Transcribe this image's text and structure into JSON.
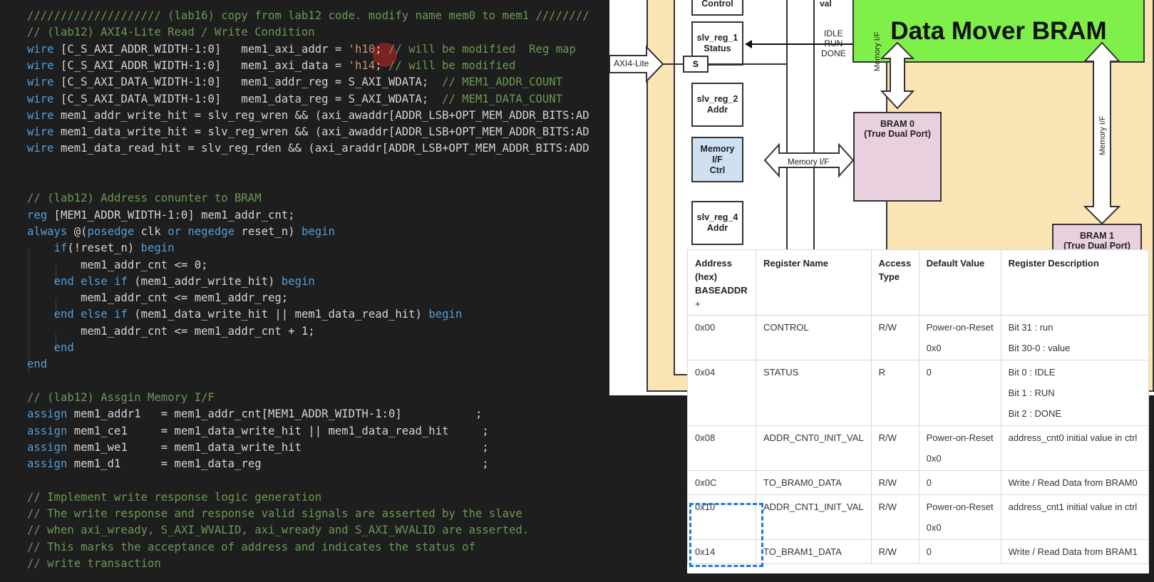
{
  "code": {
    "lines": [
      [
        [
          "cm",
          "//////////////////// (lab16) copy from lab12 code. modify name mem0 to mem1 ////////"
        ]
      ],
      [
        [
          "cm",
          "// (lab12) AXI4-Lite Read / Write Condition"
        ]
      ],
      [
        [
          "kw",
          "wire"
        ],
        [
          "pl",
          " [C_S_AXI_ADDR_WIDTH-1:0]   mem1_axi_addr = "
        ],
        [
          "str",
          "'h10"
        ],
        [
          "pl",
          ";"
        ],
        [
          "cm",
          " // will be modified  Reg map"
        ]
      ],
      [
        [
          "kw",
          "wire"
        ],
        [
          "pl",
          " [C_S_AXI_ADDR_WIDTH-1:0]   mem1_axi_data = "
        ],
        [
          "str",
          "'h14"
        ],
        [
          "pl",
          ";"
        ],
        [
          "cm",
          " // will be modified"
        ]
      ],
      [
        [
          "kw",
          "wire"
        ],
        [
          "pl",
          " [C_S_AXI_DATA_WIDTH-1:0]   mem1_addr_reg = S_AXI_WDATA;"
        ],
        [
          "cm",
          "  // MEM1_ADDR_COUNT"
        ]
      ],
      [
        [
          "kw",
          "wire"
        ],
        [
          "pl",
          " [C_S_AXI_DATA_WIDTH-1:0]   mem1_data_reg = S_AXI_WDATA;"
        ],
        [
          "cm",
          "  // MEM1_DATA_COUNT"
        ]
      ],
      [
        [
          "kw",
          "wire"
        ],
        [
          "pl",
          " mem1_addr_write_hit = slv_reg_wren && (axi_awaddr[ADDR_LSB+OPT_MEM_ADDR_BITS:AD"
        ]
      ],
      [
        [
          "kw",
          "wire"
        ],
        [
          "pl",
          " mem1_data_write_hit = slv_reg_wren && (axi_awaddr[ADDR_LSB+OPT_MEM_ADDR_BITS:AD"
        ]
      ],
      [
        [
          "kw",
          "wire"
        ],
        [
          "pl",
          " mem1_data_read_hit = slv_reg_rden && (axi_araddr[ADDR_LSB+OPT_MEM_ADDR_BITS:ADD"
        ]
      ],
      [],
      [],
      [
        [
          "cm",
          "// (lab12) Address conunter to BRAM"
        ]
      ],
      [
        [
          "kw",
          "reg"
        ],
        [
          "pl",
          " [MEM1_ADDR_WIDTH-1:0] mem1_addr_cnt;"
        ]
      ],
      [
        [
          "kw",
          "always"
        ],
        [
          "pl",
          " @("
        ],
        [
          "kw",
          "posedge"
        ],
        [
          "pl",
          " clk "
        ],
        [
          "kw",
          "or"
        ],
        [
          "pl",
          " "
        ],
        [
          "kw",
          "negedge"
        ],
        [
          "pl",
          " reset_n) "
        ],
        [
          "kw",
          "begin"
        ]
      ],
      [
        [
          "pl",
          "    "
        ],
        [
          "kw",
          "if"
        ],
        [
          "pl",
          "(!reset_n) "
        ],
        [
          "kw",
          "begin"
        ]
      ],
      [
        [
          "pl",
          "        mem1_addr_cnt <= 0;"
        ]
      ],
      [
        [
          "pl",
          "    "
        ],
        [
          "kw",
          "end"
        ],
        [
          "pl",
          " "
        ],
        [
          "kw",
          "else"
        ],
        [
          "pl",
          " "
        ],
        [
          "kw",
          "if"
        ],
        [
          "pl",
          " (mem1_addr_write_hit) "
        ],
        [
          "kw",
          "begin"
        ]
      ],
      [
        [
          "pl",
          "        mem1_addr_cnt <= mem1_addr_reg;"
        ]
      ],
      [
        [
          "pl",
          "    "
        ],
        [
          "kw",
          "end"
        ],
        [
          "pl",
          " "
        ],
        [
          "kw",
          "else"
        ],
        [
          "pl",
          " "
        ],
        [
          "kw",
          "if"
        ],
        [
          "pl",
          " (mem1_data_write_hit || mem1_data_read_hit) "
        ],
        [
          "kw",
          "begin"
        ]
      ],
      [
        [
          "pl",
          "        mem1_addr_cnt <= mem1_addr_cnt + 1;"
        ]
      ],
      [
        [
          "pl",
          "    "
        ],
        [
          "kw",
          "end"
        ]
      ],
      [
        [
          "kw",
          "end"
        ]
      ],
      [],
      [
        [
          "cm",
          "// (lab12) Assgin Memory I/F"
        ]
      ],
      [
        [
          "kw",
          "assign"
        ],
        [
          "pl",
          " mem1_addr1   = mem1_addr_cnt[MEM1_ADDR_WIDTH-1:0]           ;"
        ]
      ],
      [
        [
          "kw",
          "assign"
        ],
        [
          "pl",
          " mem1_ce1     = mem1_data_write_hit || mem1_data_read_hit     ;"
        ]
      ],
      [
        [
          "kw",
          "assign"
        ],
        [
          "pl",
          " mem1_we1     = mem1_data_write_hit                           ;"
        ]
      ],
      [
        [
          "kw",
          "assign"
        ],
        [
          "pl",
          " mem1_d1      = mem1_data_reg                                 ;"
        ]
      ],
      [],
      [
        [
          "cm",
          "// Implement write response logic generation"
        ]
      ],
      [
        [
          "cm",
          "// The write response and response valid signals are asserted by the slave"
        ]
      ],
      [
        [
          "cm",
          "// when axi_wready, S_AXI_WVALID, axi_wready and S_AXI_WVALID are asserted."
        ]
      ],
      [
        [
          "cm",
          "// This marks the acceptance of address and indicates the status of"
        ]
      ],
      [
        [
          "cm",
          "// write transaction"
        ]
      ]
    ]
  },
  "diagram": {
    "title": "Data Mover BRAM",
    "control_partial": "Control",
    "val_partial": "val",
    "axi_lite": "AXI4-Lite",
    "s_label": "S",
    "reg1_title": "slv_reg_1",
    "reg1_sub": "Status",
    "reg2_title": "slv_reg_2",
    "reg2_sub": "Addr",
    "mem_title": "Memory",
    "mem_sub1": "I/F",
    "mem_sub2": "Ctrl",
    "reg4_title": "slv_reg_4",
    "reg4_sub": "Addr",
    "status_idle": "IDLE",
    "status_run": "RUN",
    "status_done": "DONE",
    "mem_if_label": "Memory I/F",
    "mem_if_vert": "Memory I/F",
    "bram0_title": "BRAM 0",
    "bram0_sub": "(True Dual Port)",
    "bram1_title": "BRAM 1",
    "bram1_sub": "(True Dual Port)"
  },
  "table": {
    "headers": {
      "address": [
        "Address",
        "(hex)",
        "BASEADDR",
        "+"
      ],
      "name": "Register Name",
      "access": [
        "Access",
        "Type"
      ],
      "default": "Default Value",
      "desc": "Register Description"
    },
    "rows": [
      {
        "addr": "0x00",
        "name": "CONTROL",
        "access": "R/W",
        "default": [
          "Power-on-Reset",
          "0x0"
        ],
        "desc": [
          "Bit 31 : run",
          "Bit 30-0 : value"
        ]
      },
      {
        "addr": "0x04",
        "name": "STATUS",
        "access": "R",
        "default": [
          "0"
        ],
        "desc": [
          "Bit 0 : IDLE",
          "Bit 1 : RUN",
          "Bit 2 : DONE"
        ]
      },
      {
        "addr": "0x08",
        "name": "ADDR_CNT0_INIT_VAL",
        "access": "R/W",
        "default": [
          "Power-on-Reset",
          "0x0"
        ],
        "desc": [
          "address_cnt0 initial value in ctrl"
        ]
      },
      {
        "addr": "0x0C",
        "name": "TO_BRAM0_DATA",
        "access": "R/W",
        "default": [
          "0"
        ],
        "desc": [
          "Write / Read Data from BRAM0"
        ]
      },
      {
        "addr": "0x10",
        "name": "ADDR_CNT1_INIT_VAL",
        "access": "R/W",
        "default": [
          "Power-on-Reset",
          "0x0"
        ],
        "desc": [
          "address_cnt1 initial value in ctrl"
        ]
      },
      {
        "addr": "0x14",
        "name": "TO_BRAM1_DATA",
        "access": "R/W",
        "default": [
          "0"
        ],
        "desc": [
          "Write / Read Data from BRAM1"
        ]
      }
    ]
  }
}
